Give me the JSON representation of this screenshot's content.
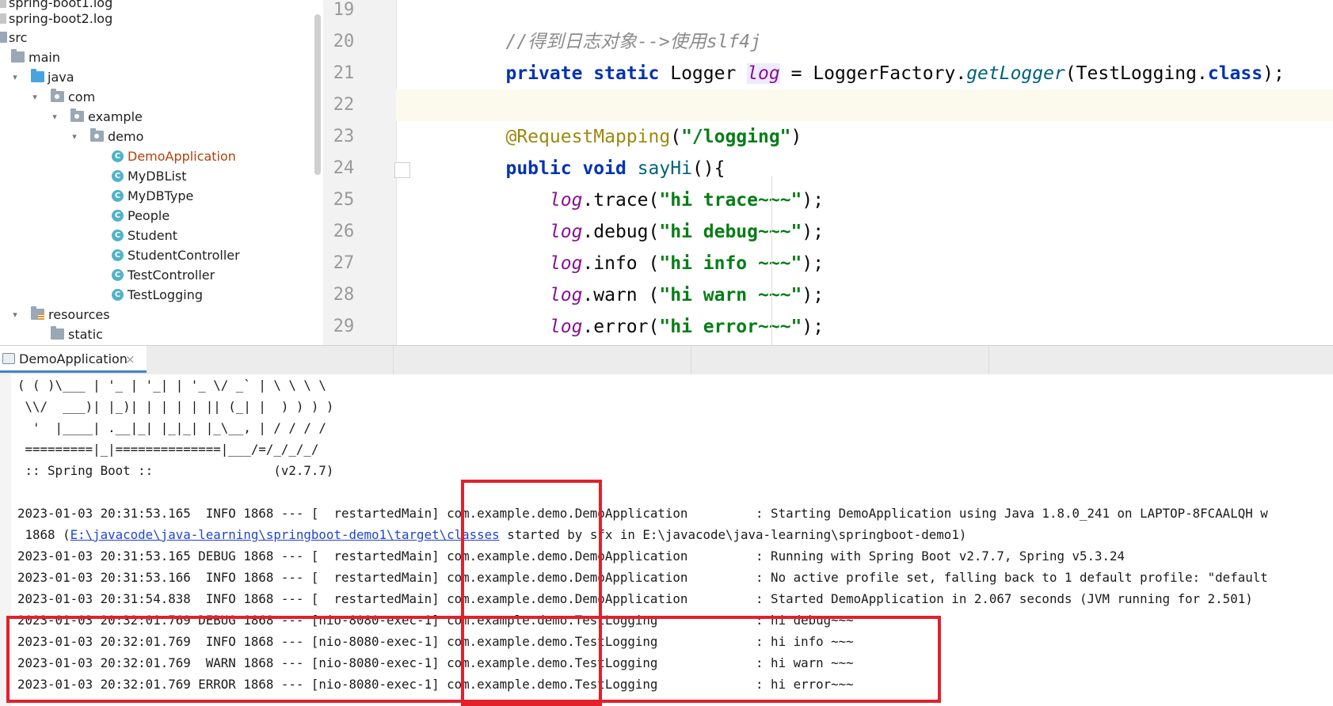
{
  "project_tree": {
    "items": [
      {
        "label": "spring-boot1.log",
        "icon": "log-file-icon"
      },
      {
        "label": "spring-boot2.log",
        "icon": "log-file-icon"
      },
      {
        "label": "src",
        "icon": "folder-icon"
      },
      {
        "label": "main",
        "icon": "folder-icon"
      },
      {
        "label": "java",
        "icon": "source-folder-icon",
        "expanded": true
      },
      {
        "label": "com",
        "icon": "package-icon",
        "expanded": true
      },
      {
        "label": "example",
        "icon": "package-icon",
        "expanded": true
      },
      {
        "label": "demo",
        "icon": "package-icon",
        "expanded": true
      },
      {
        "label": "DemoApplication",
        "icon": "spring-boot-class-icon",
        "color": "#b0410d"
      },
      {
        "label": "MyDBList",
        "icon": "class-icon"
      },
      {
        "label": "MyDBType",
        "icon": "class-icon"
      },
      {
        "label": "People",
        "icon": "class-icon"
      },
      {
        "label": "Student",
        "icon": "class-icon"
      },
      {
        "label": "StudentController",
        "icon": "class-icon"
      },
      {
        "label": "TestController",
        "icon": "class-icon"
      },
      {
        "label": "TestLogging",
        "icon": "class-icon"
      },
      {
        "label": "resources",
        "icon": "resources-folder-icon",
        "expanded": true
      },
      {
        "label": "static",
        "icon": "folder-icon"
      }
    ]
  },
  "editor": {
    "line_numbers": [
      "19",
      "20",
      "21",
      "22",
      "23",
      "24",
      "25",
      "26",
      "27",
      "28",
      "29"
    ],
    "current_line": "22",
    "code": {
      "l20_comment": "//得到日志对象-->使用slf4j",
      "l21": {
        "kw1": "private",
        "kw2": "static",
        "type": "Logger",
        "field": "log",
        "eq": "=",
        "cls": "LoggerFactory.",
        "method": "getLogger",
        "open": "(",
        "arg": "TestLogging.",
        "kw3": "class",
        "close": ");"
      },
      "l23": {
        "annotation": "@RequestMapping",
        "open": "(",
        "str": "\"/logging\"",
        "close": ")"
      },
      "l24": {
        "kw1": "public",
        "kw2": "void",
        "method": "sayHi",
        "rest": "(){"
      },
      "calls": [
        {
          "field": "log",
          "method": ".trace",
          "open": "(",
          "str": "\"hi trace~~~\"",
          "close": ");"
        },
        {
          "field": "log",
          "method": ".debug",
          "open": "(",
          "str": "\"hi debug~~~\"",
          "close": ");"
        },
        {
          "field": "log",
          "method": ".info",
          "open": " (",
          "str": "\"hi info ~~~\"",
          "close": ");"
        },
        {
          "field": "log",
          "method": ".warn",
          "open": " (",
          "str": "\"hi warn ~~~\"",
          "close": ");"
        },
        {
          "field": "log",
          "method": ".error",
          "open": "(",
          "str": "\"hi error~~~\"",
          "close": ");"
        }
      ]
    }
  },
  "run_panel": {
    "tab_label": "DemoApplication",
    "close_glyph": "×"
  },
  "console": {
    "banner": [
      "( ( )\\___ | '_ | '_| | '_ \\/ _` | \\ \\ \\ \\",
      " \\\\/  ___)| |_)| | | | | || (_| |  ) ) ) )",
      "  '  |____| .__|_| |_|_| |_\\__, | / / / /",
      " =========|_|==============|___/=/_/_/_/",
      " :: Spring Boot ::                (v2.7.7)"
    ],
    "log_lines": [
      "2023-01-03 20:31:53.165  INFO 1868 --- [  restartedMain] com.example.demo.DemoApplication         : Starting DemoApplication using Java 1.8.0_241 on LAPTOP-8FCAALQH w",
      "2023-01-03 20:31:53.165 DEBUG 1868 --- [  restartedMain] com.example.demo.DemoApplication         : Running with Spring Boot v2.7.7, Spring v5.3.24",
      "2023-01-03 20:31:53.166  INFO 1868 --- [  restartedMain] com.example.demo.DemoApplication         : No active profile set, falling back to 1 default profile: \"default",
      "2023-01-03 20:31:54.838  INFO 1868 --- [  restartedMain] com.example.demo.DemoApplication         : Started DemoApplication in 2.067 seconds (JVM running for 2.501)",
      "2023-01-03 20:32:01.769 DEBUG 1868 --- [nio-8080-exec-1] com.example.demo.TestLogging             : hi debug~~~",
      "2023-01-03 20:32:01.769  INFO 1868 --- [nio-8080-exec-1] com.example.demo.TestLogging             : hi info ~~~",
      "2023-01-03 20:32:01.769  WARN 1868 --- [nio-8080-exec-1] com.example.demo.TestLogging             : hi warn ~~~",
      "2023-01-03 20:32:01.769 ERROR 1868 --- [nio-8080-exec-1] com.example.demo.TestLogging             : hi error~~~"
    ],
    "continuation": {
      "prefix": " 1868 (",
      "link": "E:\\javacode\\java-learning\\springboot-demo1\\target\\classes",
      "suffix": " started by sfx in E:\\javacode\\java-learning\\springboot-demo1)"
    }
  },
  "colors": {
    "highlight_box": "#e2212b",
    "keyword": "#0033b3",
    "string": "#067d17",
    "comment": "#8c8c8c",
    "annotation": "#9e880d",
    "field": "#871094",
    "tab_underline": "#4083c9"
  }
}
